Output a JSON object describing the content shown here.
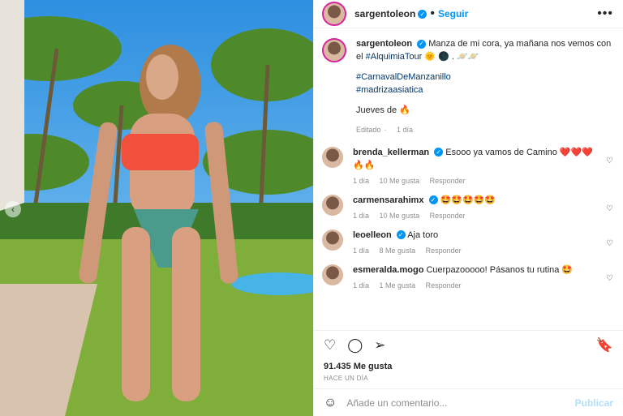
{
  "post": {
    "username": "sargentoleon",
    "follow_label": "Seguir",
    "more": "•••",
    "carousel_prev": "‹"
  },
  "caption": {
    "username": "sargentoleon",
    "line1": "Manza de mi cora, ya mañana nos vemos con el",
    "hashtag_tour": "#AlquimiaTour",
    "line1_end": "🌞 🌑 . 🪐🪐",
    "tag1": "#CarnavalDeManzanillo",
    "tag2": "#madrizaasiatica",
    "jueves": "Jueves de 🔥",
    "edited": "Editado",
    "edited_time": "1 día"
  },
  "comments": [
    {
      "username": "brenda_kellerman",
      "verified": true,
      "text": "Esooo ya vamos de Camino ❤️❤️❤️ 🔥🔥",
      "time": "1 día",
      "likes": "10 Me gusta",
      "reply": "Responder"
    },
    {
      "username": "carmensarahimx",
      "verified": true,
      "text": "🤩🤩🤩🤩🤩",
      "time": "1 día",
      "likes": "10 Me gusta",
      "reply": "Responder"
    },
    {
      "username": "leoelleon",
      "verified": true,
      "text": "Aja toro",
      "time": "1 día",
      "likes": "8 Me gusta",
      "reply": "Responder"
    },
    {
      "username": "esmeralda.mogo",
      "verified": false,
      "text": "Cuerpazooooo! Pásanos tu rutina 🤩",
      "time": "1 día",
      "likes": "1 Me gusta",
      "reply": "Responder"
    }
  ],
  "actions": {
    "likes": "91.435 Me gusta",
    "timestamp": "HACE UN DÍA"
  },
  "add_comment": {
    "placeholder": "Añade un comentario...",
    "post_label": "Publicar"
  }
}
